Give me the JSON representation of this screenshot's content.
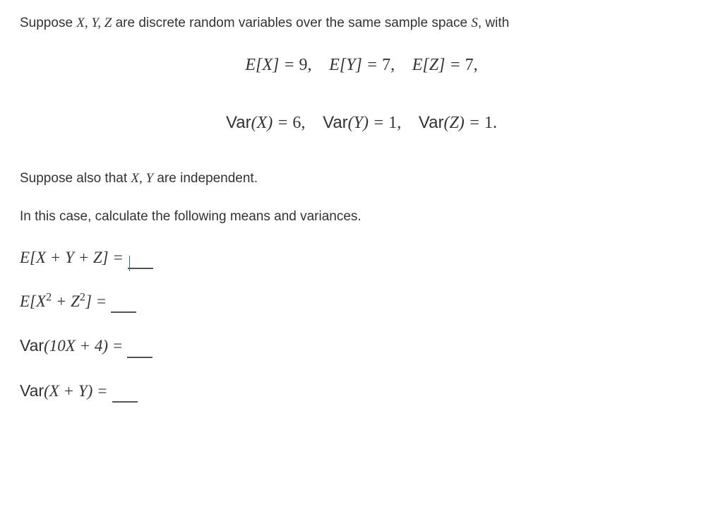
{
  "intro": {
    "prefix": "Suppose ",
    "vars": "X, Y, Z",
    "mid": " are discrete random variables over the same sample space ",
    "space": "S",
    "suffix": ", with"
  },
  "expectations": {
    "e1_lhs": "E[X] = ",
    "e1_val": "9",
    "e2_lhs": "E[Y] = ",
    "e2_val": "7",
    "e3_lhs": "E[Z] = ",
    "e3_val": "7",
    "sep": ",",
    "final": ","
  },
  "variances": {
    "v1_lhs": "(X) = ",
    "v1_val": "6",
    "v2_lhs": "(Y) = ",
    "v2_val": "1",
    "v3_lhs": "(Z) = ",
    "v3_val": "1",
    "var_label": "Var",
    "sep": ",",
    "final": "."
  },
  "cond": {
    "prefix": "Suppose also that ",
    "vars": "X, Y",
    "suffix": " are independent."
  },
  "task": "In this case, calculate the following means and variances.",
  "questions": {
    "q1": "E[X + Y + Z] = ",
    "q2_pre": "E[X",
    "q2_mid": " + Z",
    "q2_post": "] = ",
    "q2_exp": "2",
    "q3_var": "Var",
    "q3_body": "(10X + 4) = ",
    "q4_var": "Var",
    "q4_body": "(X + Y) = "
  }
}
